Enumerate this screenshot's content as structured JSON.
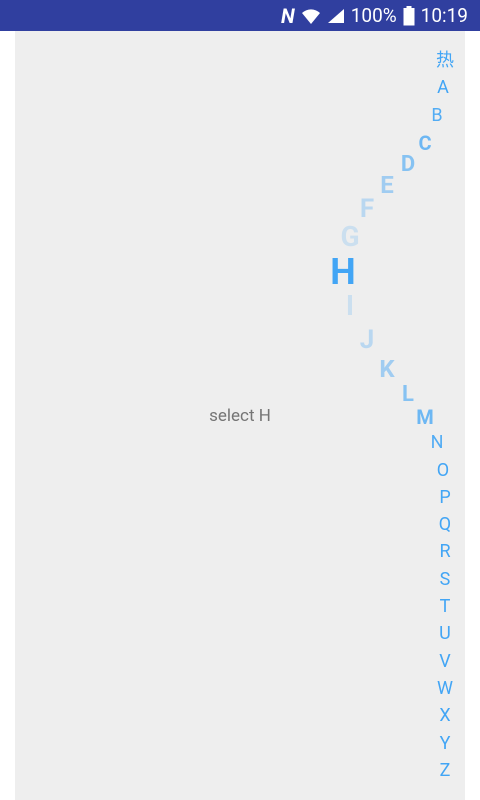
{
  "status_bar": {
    "nfc": "N",
    "battery": "100%",
    "time": "10:19"
  },
  "selected_text": "select H",
  "index": {
    "letters": [
      {
        "label": "热"
      },
      {
        "label": "A"
      },
      {
        "label": "B"
      },
      {
        "label": "C"
      },
      {
        "label": "D"
      },
      {
        "label": "E"
      },
      {
        "label": "F"
      },
      {
        "label": "G"
      },
      {
        "label": "H"
      },
      {
        "label": "I"
      },
      {
        "label": "J"
      },
      {
        "label": "K"
      },
      {
        "label": "L"
      },
      {
        "label": "M"
      },
      {
        "label": "N"
      },
      {
        "label": "O"
      },
      {
        "label": "P"
      },
      {
        "label": "Q"
      },
      {
        "label": "R"
      },
      {
        "label": "S"
      },
      {
        "label": "T"
      },
      {
        "label": "U"
      },
      {
        "label": "V"
      },
      {
        "label": "W"
      },
      {
        "label": "X"
      },
      {
        "label": "Y"
      },
      {
        "label": "Z"
      }
    ],
    "selected": "H",
    "accent_color": "#42A5F5"
  },
  "colors": {
    "status_bar": "#303F9F",
    "background": "#EEEEEE",
    "text": "#757575"
  }
}
